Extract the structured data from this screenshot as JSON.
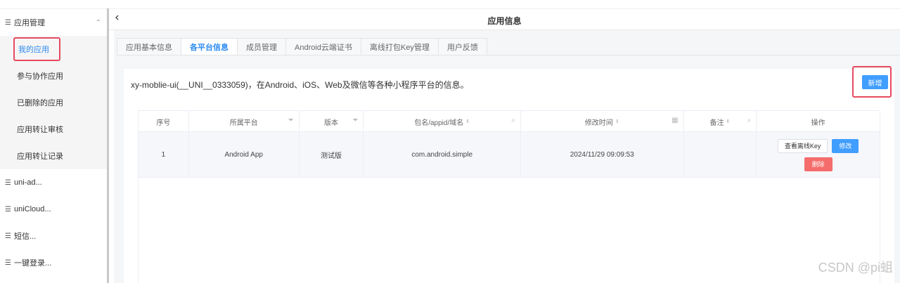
{
  "sidebar": {
    "groups": [
      {
        "label": "应用管理",
        "expanded": true
      },
      {
        "label": "uni-ad..."
      },
      {
        "label": "uniCloud..."
      },
      {
        "label": "短信..."
      },
      {
        "label": "一键登录..."
      }
    ],
    "sub_items": [
      {
        "label": "我的应用",
        "active": true
      },
      {
        "label": "参与协作应用"
      },
      {
        "label": "已删除的应用"
      },
      {
        "label": "应用转让审核"
      },
      {
        "label": "应用转让记录"
      }
    ]
  },
  "header": {
    "title": "应用信息"
  },
  "tabs": [
    {
      "label": "应用基本信息"
    },
    {
      "label": "各平台信息",
      "active": true
    },
    {
      "label": "成员管理"
    },
    {
      "label": "Android云端证书"
    },
    {
      "label": "离线打包Key管理"
    },
    {
      "label": "用户反馈"
    }
  ],
  "panel": {
    "description": "xy-moblie-ui(__UNI__0333059)，在Android、iOS、Web及微信等各种小程序平台的信息。",
    "add_button": "新增"
  },
  "table": {
    "columns": [
      "序号",
      "所属平台",
      "版本",
      "包名/appid/域名",
      "修改时间",
      "备注",
      "操作"
    ],
    "rows": [
      {
        "index": "1",
        "platform": "Android App",
        "version": "测试版",
        "package": "com.android.simple",
        "modified": "2024/11/29 09:09:53",
        "note": "",
        "actions": {
          "view_key": "查看离线Key",
          "edit": "修改",
          "delete": "删除"
        }
      }
    ]
  },
  "watermark": "CSDN @pi蛆",
  "colors": {
    "accent": "#409eff",
    "danger": "#f56c6c",
    "highlight": "#e84a5f"
  }
}
